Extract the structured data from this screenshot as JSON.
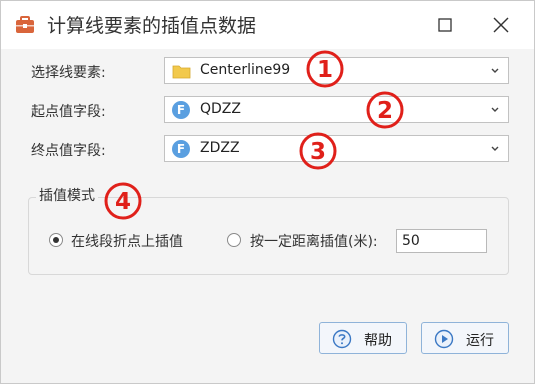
{
  "window": {
    "title": "计算线要素的插值点数据"
  },
  "form": {
    "line_feature": {
      "label": "选择线要素:",
      "value": "Centerline99"
    },
    "start_field": {
      "label": "起点值字段:",
      "value": "QDZZ",
      "icon_letter": "F"
    },
    "end_field": {
      "label": "终点值字段:",
      "value": "ZDZZ",
      "icon_letter": "F"
    }
  },
  "badges": [
    "1",
    "2",
    "3",
    "4"
  ],
  "interpolation": {
    "group_label": "插值模式",
    "option_vertex": "在线段折点上插值",
    "option_distance": "按一定距离插值(米):",
    "selected": "vertex",
    "distance_value": "50"
  },
  "buttons": {
    "help": "帮助",
    "run": "运行"
  },
  "colors": {
    "badge_red": "#e0201a",
    "field_icon": "#5a9fe0",
    "folder_yellow": "#f2c94c",
    "app_icon": "#d9653b"
  }
}
